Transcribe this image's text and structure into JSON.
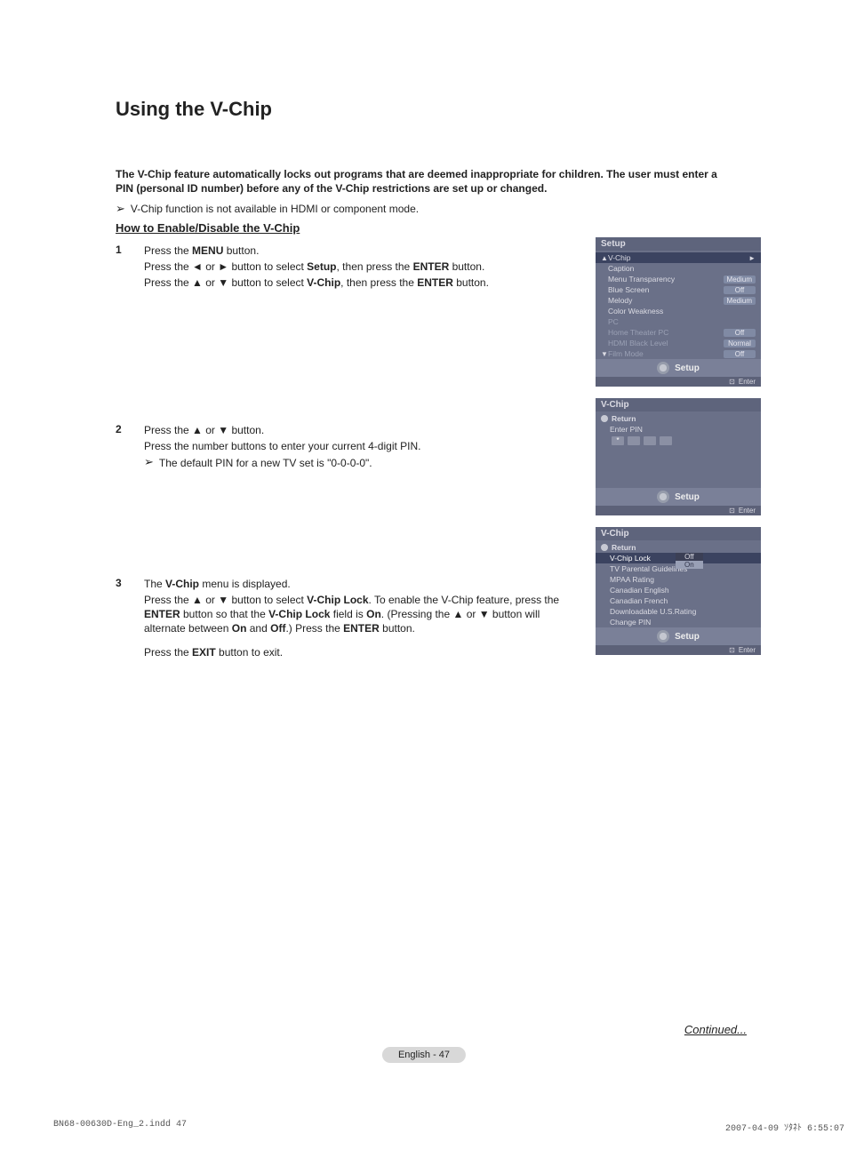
{
  "title": "Using the V-Chip",
  "intro_bold": "The V-Chip feature automatically locks out programs that are deemed inappropriate for children. The user must enter a PIN (personal ID number) before any of the V-Chip restrictions are set up or changed.",
  "intro_note": "V-Chip function is not available in HDMI or component mode.",
  "section_heading": "How to Enable/Disable the V-Chip",
  "steps": {
    "s1": {
      "num": "1",
      "l1a": "Press the ",
      "l1b": "MENU",
      "l1c": " button.",
      "l2a": "Press the ◄ or ► button to select ",
      "l2b": "Setup",
      "l2c": ", then press the ",
      "l2d": "ENTER",
      "l2e": " button.",
      "l3a": "Press the ▲ or ▼ button to select ",
      "l3b": "V-Chip",
      "l3c": ", then press the ",
      "l3d": "ENTER",
      "l3e": " button."
    },
    "s2": {
      "num": "2",
      "l1": "Press the ▲ or ▼ button.",
      "l2": "Press the number buttons to enter your current 4-digit PIN.",
      "note": "The default PIN for a new TV set is \"0-0-0-0\"."
    },
    "s3": {
      "num": "3",
      "l1a": "The ",
      "l1b": "V-Chip",
      "l1c": " menu is displayed.",
      "l2a": "Press the ▲ or ▼ button to select ",
      "l2b": "V-Chip Lock",
      "l2c": ". To enable the V-Chip feature, press the ",
      "l2d": "ENTER",
      "l2e": " button so that the ",
      "l2f": "V-Chip Lock",
      "l2g": " field is ",
      "l2h": "On",
      "l2i": ". (Pressing the ▲ or ▼ button will alternate between ",
      "l2j": "On",
      "l2k": " and ",
      "l2l": "Off",
      "l2m": ".) Press the ",
      "l2n": "ENTER",
      "l2o": " button.",
      "l3a": "Press the ",
      "l3b": "EXIT",
      "l3c": " button to exit."
    }
  },
  "continued": "Continued...",
  "page_label": "English - 47",
  "doc_footer_left": "BN68-00630D-Eng_2.indd   47",
  "doc_footer_right": "2007-04-09   ｿﾀﾈﾄ 6:55:07",
  "osd1": {
    "title": "Setup",
    "rows": {
      "vchip": "V-Chip",
      "caption": "Caption",
      "menu_transp_k": "Menu Transparency",
      "menu_transp_v": "Medium",
      "blue_k": "Blue Screen",
      "blue_v": "Off",
      "melody_k": "Melody",
      "melody_v": "Medium",
      "color_weak": "Color Weakness",
      "pc": "PC",
      "home_k": "Home Theater PC",
      "home_v": "Off",
      "hdmi_k": "HDMI Black Level",
      "hdmi_v": "Normal",
      "film_k": "Film Mode",
      "film_v": "Off"
    },
    "strip": "Setup",
    "footer": "Enter"
  },
  "osd2": {
    "title": "V-Chip",
    "return": "Return",
    "enter_pin": "Enter PIN",
    "ast": "*",
    "strip": "Setup",
    "footer": "Enter"
  },
  "osd3": {
    "title": "V-Chip",
    "return": "Return",
    "vchip_lock": "V-Chip Lock",
    "off": "Off",
    "on": "On",
    "tv_par": "TV Parental Guidelines",
    "mpaa": "MPAA Rating",
    "can_en": "Canadian English",
    "can_fr": "Canadian French",
    "dl_us": "Downloadable U.S.Rating",
    "change_pin": "Change PIN",
    "strip": "Setup",
    "footer": "Enter"
  }
}
